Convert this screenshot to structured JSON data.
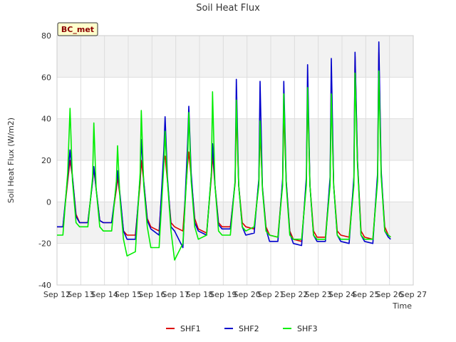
{
  "chart_data": {
    "type": "line",
    "title": "Soil Heat Flux",
    "xlabel": "Time",
    "ylabel": "Soil Heat Flux (W/m2)",
    "station_badge": "BC_met",
    "ylim": [
      -40,
      80
    ],
    "yticks": [
      -40,
      -20,
      0,
      20,
      40,
      60,
      80
    ],
    "xlim": [
      12,
      27
    ],
    "xticks": [
      {
        "value": 12,
        "label": "Sep 12"
      },
      {
        "value": 13,
        "label": "Sep 13"
      },
      {
        "value": 14,
        "label": "Sep 14"
      },
      {
        "value": 15,
        "label": "Sep 15"
      },
      {
        "value": 16,
        "label": "Sep 16"
      },
      {
        "value": 17,
        "label": "Sep 17"
      },
      {
        "value": 18,
        "label": "Sep 18"
      },
      {
        "value": 19,
        "label": "Sep 19"
      },
      {
        "value": 20,
        "label": "Sep 20"
      },
      {
        "value": 21,
        "label": "Sep 21"
      },
      {
        "value": 22,
        "label": "Sep 22"
      },
      {
        "value": 23,
        "label": "Sep 23"
      },
      {
        "value": 24,
        "label": "Sep 24"
      },
      {
        "value": 25,
        "label": "Sep 25"
      },
      {
        "value": 26,
        "label": "Sep 26"
      },
      {
        "value": 27,
        "label": "Sep 27"
      }
    ],
    "grid": true,
    "legend_position": "bottom",
    "series": [
      {
        "name": "SHF1",
        "color": "#dd0000",
        "x": [
          12.0,
          12.25,
          12.45,
          12.55,
          12.65,
          12.8,
          12.95,
          13.3,
          13.5,
          13.55,
          13.65,
          13.8,
          13.95,
          14.3,
          14.5,
          14.55,
          14.65,
          14.8,
          14.95,
          15.3,
          15.5,
          15.55,
          15.65,
          15.8,
          15.95,
          16.3,
          16.5,
          16.55,
          16.65,
          16.8,
          16.95,
          17.3,
          17.5,
          17.55,
          17.65,
          17.8,
          17.95,
          18.3,
          18.5,
          18.55,
          18.65,
          18.8,
          18.95,
          19.3,
          19.5,
          19.55,
          19.65,
          19.8,
          19.95,
          20.3,
          20.5,
          20.55,
          20.65,
          20.8,
          20.95,
          21.3,
          21.5,
          21.55,
          21.65,
          21.8,
          21.95,
          22.3,
          22.5,
          22.55,
          22.65,
          22.8,
          22.95,
          23.3,
          23.5,
          23.55,
          23.65,
          23.8,
          23.95,
          24.3,
          24.5,
          24.55,
          24.65,
          24.8,
          24.95,
          25.3,
          25.5,
          25.55,
          25.65,
          25.8,
          25.95,
          26.05
        ],
        "y": [
          -12,
          -12,
          10,
          20,
          12,
          -6,
          -10,
          -10,
          10,
          16,
          6,
          -9,
          -10,
          -10,
          6,
          12,
          3,
          -14,
          -16,
          -16,
          9,
          20,
          10,
          -8,
          -12,
          -14,
          20,
          22,
          10,
          -10,
          -12,
          -14,
          18,
          24,
          12,
          -8,
          -13,
          -15,
          12,
          23,
          8,
          -10,
          -12,
          -12,
          9,
          45,
          8,
          -10,
          -12,
          -13,
          10,
          35,
          7,
          -12,
          -16,
          -17,
          10,
          45,
          10,
          -14,
          -18,
          -19,
          10,
          55,
          8,
          -14,
          -17,
          -17,
          10,
          55,
          8,
          -14,
          -16,
          -17,
          10,
          70,
          20,
          -14,
          -17,
          -18,
          12,
          72,
          13,
          -12,
          -16,
          -17
        ]
      },
      {
        "name": "SHF2",
        "color": "#0000cc",
        "x": [
          12.0,
          12.25,
          12.45,
          12.55,
          12.65,
          12.8,
          12.95,
          13.3,
          13.5,
          13.55,
          13.65,
          13.8,
          13.95,
          14.3,
          14.5,
          14.55,
          14.65,
          14.8,
          14.95,
          15.3,
          15.5,
          15.55,
          15.65,
          15.8,
          15.95,
          16.3,
          16.5,
          16.55,
          16.65,
          16.8,
          16.95,
          17.3,
          17.5,
          17.55,
          17.65,
          17.8,
          17.95,
          18.3,
          18.5,
          18.55,
          18.65,
          18.8,
          18.95,
          19.3,
          19.5,
          19.55,
          19.65,
          19.8,
          19.95,
          20.3,
          20.5,
          20.55,
          20.65,
          20.8,
          20.95,
          21.3,
          21.5,
          21.55,
          21.65,
          21.8,
          21.95,
          22.3,
          22.5,
          22.55,
          22.65,
          22.8,
          22.95,
          23.3,
          23.5,
          23.55,
          23.65,
          23.8,
          23.95,
          24.3,
          24.5,
          24.55,
          24.65,
          24.8,
          24.95,
          25.3,
          25.5,
          25.55,
          25.65,
          25.8,
          25.95,
          26.05
        ],
        "y": [
          -12,
          -12,
          12,
          25,
          12,
          -7,
          -10,
          -10,
          10,
          17,
          6,
          -9,
          -10,
          -10,
          8,
          15,
          4,
          -14,
          -18,
          -18,
          12,
          30,
          10,
          -9,
          -13,
          -16,
          25,
          41,
          12,
          -12,
          -14,
          -22,
          28,
          46,
          14,
          -10,
          -14,
          -16,
          14,
          28,
          8,
          -11,
          -13,
          -13,
          10,
          59,
          8,
          -12,
          -16,
          -15,
          11,
          58,
          7,
          -13,
          -19,
          -19,
          11,
          58,
          10,
          -15,
          -20,
          -21,
          12,
          66,
          8,
          -16,
          -19,
          -19,
          12,
          69,
          8,
          -16,
          -19,
          -20,
          12,
          72,
          20,
          -16,
          -19,
          -20,
          14,
          77,
          15,
          -14,
          -17,
          -18
        ]
      },
      {
        "name": "SHF3",
        "color": "#00ee00",
        "x": [
          12.0,
          12.25,
          12.45,
          12.55,
          12.65,
          12.8,
          12.95,
          13.3,
          13.5,
          13.55,
          13.65,
          13.8,
          13.95,
          14.3,
          14.5,
          14.55,
          14.65,
          14.8,
          14.95,
          15.3,
          15.5,
          15.55,
          15.65,
          15.8,
          15.95,
          16.3,
          16.5,
          16.55,
          16.65,
          16.8,
          16.95,
          17.3,
          17.5,
          17.55,
          17.65,
          17.8,
          17.95,
          18.3,
          18.5,
          18.55,
          18.65,
          18.8,
          18.95,
          19.3,
          19.5,
          19.55,
          19.65,
          19.8,
          19.95,
          20.3,
          20.5,
          20.55,
          20.65,
          20.8,
          20.95,
          21.3,
          21.5,
          21.55,
          21.65,
          21.8,
          21.95,
          22.3,
          22.5,
          22.55,
          22.65,
          22.8,
          22.95,
          23.3,
          23.5,
          23.55,
          23.65,
          23.8,
          23.95,
          24.3,
          24.5,
          24.55,
          24.65,
          24.8,
          24.95,
          25.3,
          25.5,
          25.55,
          25.65,
          25.8,
          25.95,
          26.05
        ],
        "y": [
          -16,
          -16,
          14,
          45,
          10,
          -10,
          -12,
          -12,
          12,
          38,
          6,
          -12,
          -14,
          -14,
          10,
          27,
          2,
          -18,
          -26,
          -24,
          14,
          44,
          8,
          -12,
          -22,
          -22,
          18,
          34,
          10,
          -14,
          -28,
          -20,
          20,
          43,
          10,
          -12,
          -18,
          -16,
          14,
          53,
          8,
          -14,
          -16,
          -16,
          10,
          49,
          8,
          -12,
          -14,
          -12,
          8,
          39,
          6,
          -14,
          -16,
          -17,
          8,
          52,
          8,
          -16,
          -18,
          -18,
          8,
          55,
          8,
          -16,
          -18,
          -18,
          8,
          52,
          8,
          -16,
          -18,
          -18,
          8,
          62,
          18,
          -16,
          -18,
          -18,
          10,
          63,
          12,
          -14,
          -16,
          -17
        ]
      }
    ]
  }
}
